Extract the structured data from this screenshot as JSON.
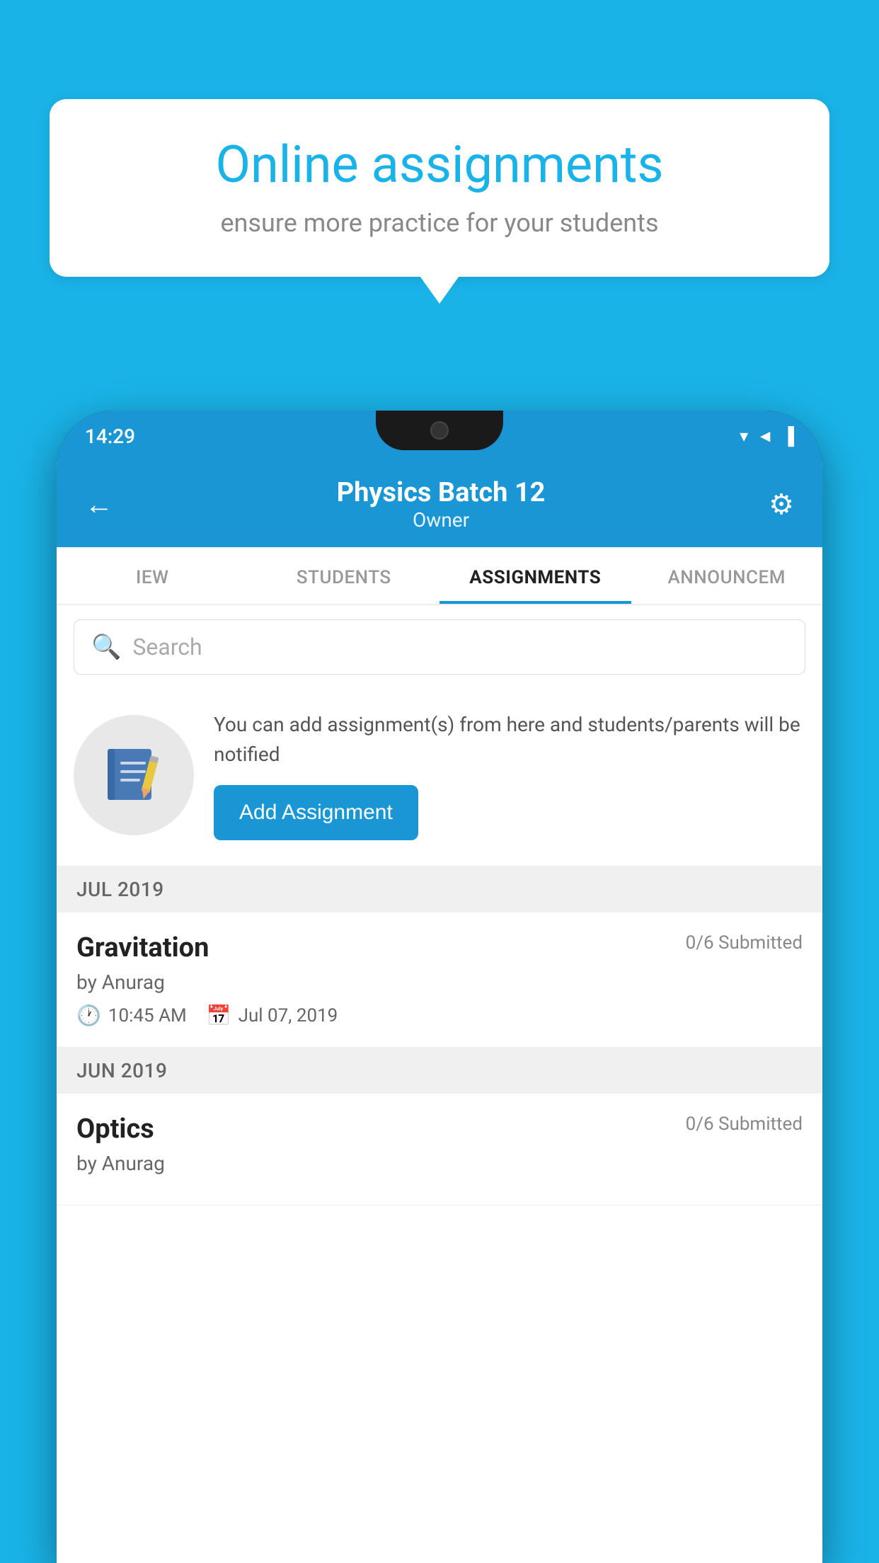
{
  "background_color": "#1ab3e8",
  "speech_bubble": {
    "title": "Online assignments",
    "subtitle": "ensure more practice for your students"
  },
  "phone": {
    "status_bar": {
      "time": "14:29",
      "signal_icon": "▼◄▐"
    },
    "header": {
      "back_icon": "←",
      "title": "Physics Batch 12",
      "subtitle": "Owner",
      "gear_icon": "⚙"
    },
    "tabs": [
      {
        "label": "IEW",
        "active": false
      },
      {
        "label": "STUDENTS",
        "active": false
      },
      {
        "label": "ASSIGNMENTS",
        "active": true
      },
      {
        "label": "ANNOUNCEM",
        "active": false
      }
    ],
    "search": {
      "placeholder": "Search"
    },
    "promo": {
      "description": "You can add assignment(s) from here and students/parents will be notified",
      "button_label": "Add Assignment"
    },
    "assignments": [
      {
        "month_label": "JUL 2019",
        "items": [
          {
            "name": "Gravitation",
            "submitted": "0/6 Submitted",
            "by": "by Anurag",
            "time": "10:45 AM",
            "date": "Jul 07, 2019"
          }
        ]
      },
      {
        "month_label": "JUN 2019",
        "items": [
          {
            "name": "Optics",
            "submitted": "0/6 Submitted",
            "by": "by Anurag",
            "time": "",
            "date": ""
          }
        ]
      }
    ]
  }
}
